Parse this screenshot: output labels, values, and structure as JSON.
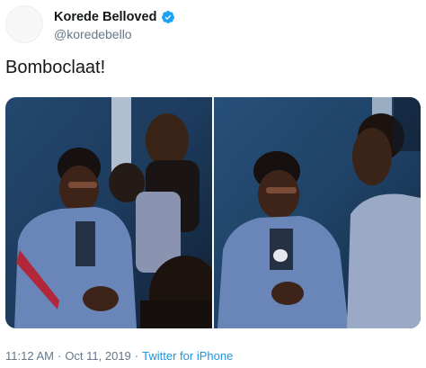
{
  "user": {
    "display_name": "Korede Belloved",
    "handle": "@koredebello",
    "verified_icon": "verified-badge-icon",
    "avatar_icon": "avatar-icon"
  },
  "tweet": {
    "text": "Bomboclaat!"
  },
  "media": {
    "photos": [
      {
        "icon": "photo-left"
      },
      {
        "icon": "photo-right"
      }
    ]
  },
  "meta": {
    "time": "11:12 AM",
    "separator1": "·",
    "date": "Oct 11, 2019",
    "separator2": "·",
    "source": "Twitter for iPhone"
  },
  "colors": {
    "link": "#1b95e0",
    "secondary_text": "#657786",
    "verified": "#1da1f2"
  }
}
